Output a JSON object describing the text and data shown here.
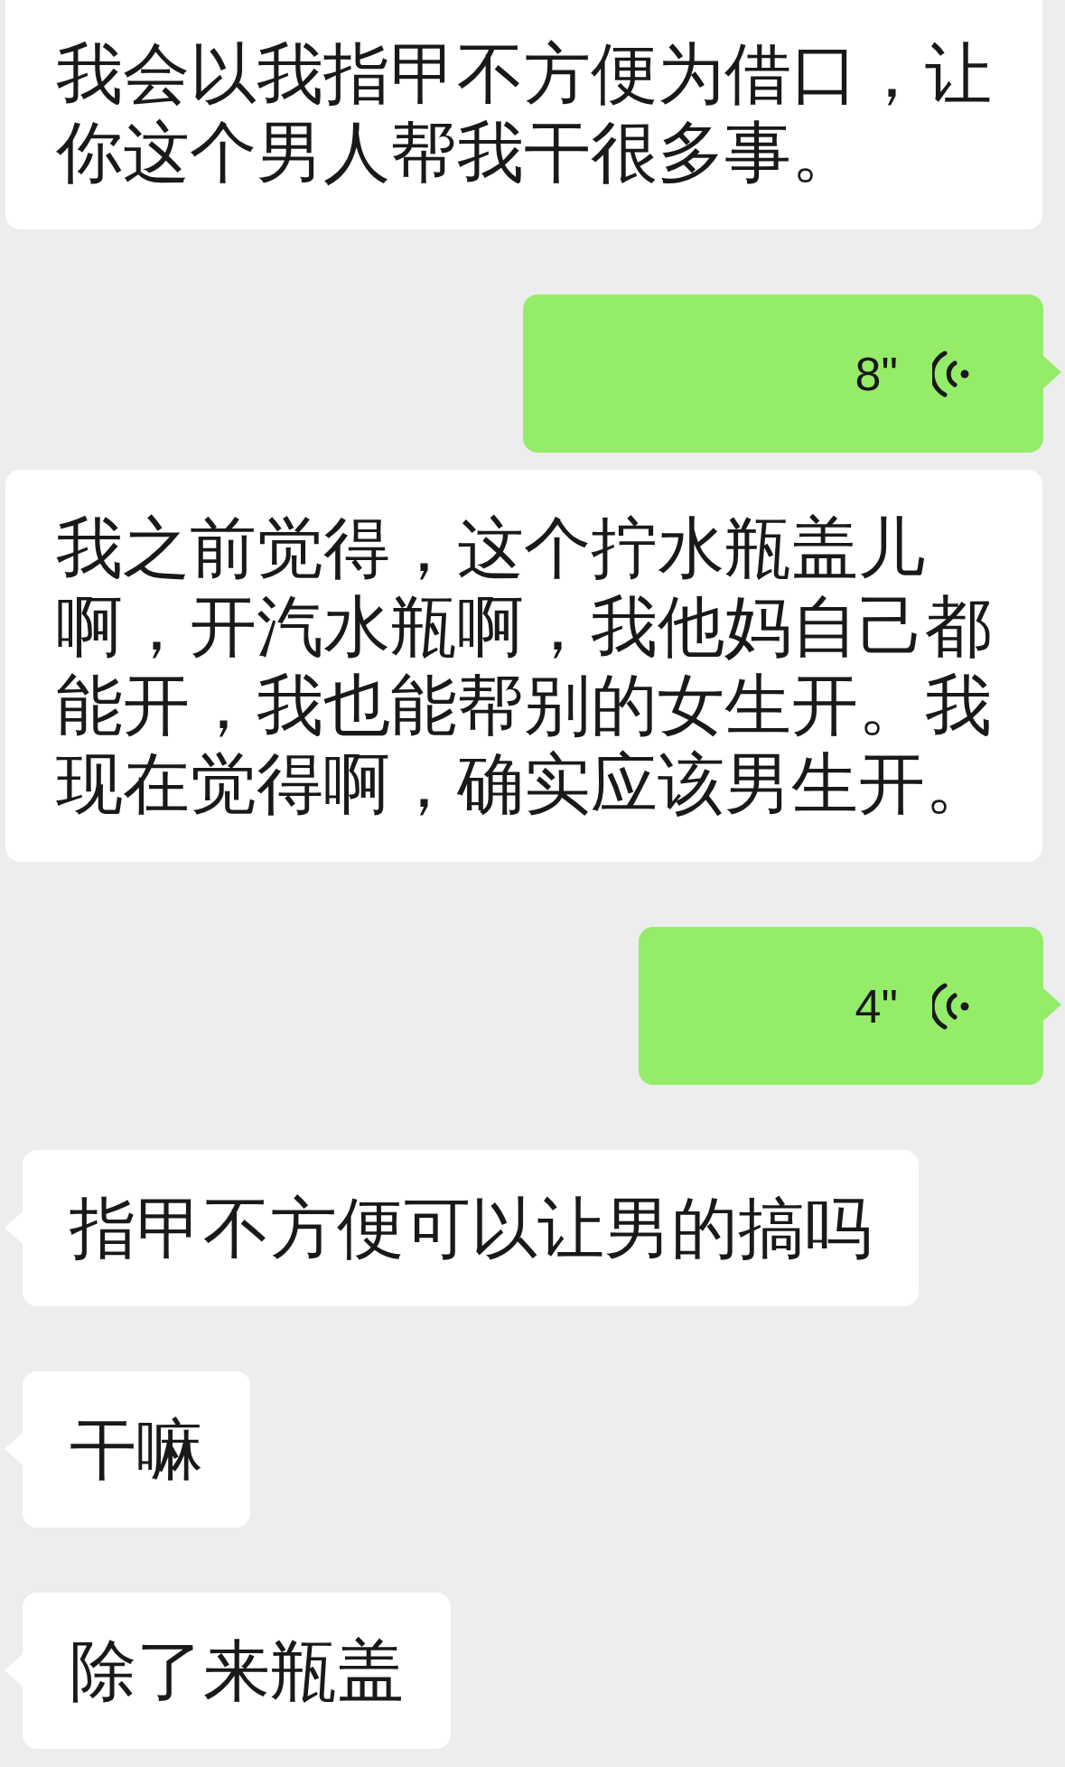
{
  "messages": [
    {
      "kind": "text",
      "outgoing": false,
      "tail": false,
      "text": "我会以我指甲不方便为借口，让你这个男人帮我干很多事。"
    },
    {
      "kind": "voice",
      "outgoing": true,
      "tail": true,
      "duration": "8\""
    },
    {
      "kind": "text",
      "outgoing": false,
      "tail": false,
      "text": "我之前觉得，这个拧水瓶盖儿啊，开汽水瓶啊，我他妈自己都能开，我也能帮别的女生开。我现在觉得啊，确实应该男生开。"
    },
    {
      "kind": "voice",
      "outgoing": true,
      "tail": true,
      "duration": "4\""
    },
    {
      "kind": "text",
      "outgoing": false,
      "tail": true,
      "text": "指甲不方便可以让男的搞吗"
    },
    {
      "kind": "text",
      "outgoing": false,
      "tail": true,
      "text": "干嘛"
    },
    {
      "kind": "text",
      "outgoing": false,
      "tail": true,
      "text": "除了来瓶盖"
    }
  ]
}
